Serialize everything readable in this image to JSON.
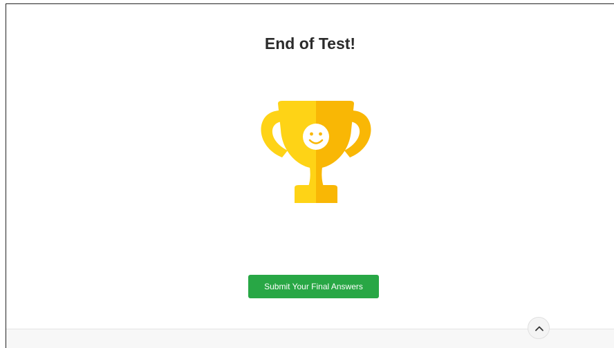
{
  "page": {
    "title": "End of Test!"
  },
  "trophy": {
    "icon": "trophy-icon",
    "face_icon": "smiley-face-icon",
    "colors": {
      "light": "#fed316",
      "dark": "#f9b705",
      "face": "#ffffff"
    }
  },
  "actions": {
    "submit_label": "Submit Your Final Answers",
    "submit_color": "#28a745"
  },
  "footer": {
    "scroll_up_icon": "chevron-up-icon"
  }
}
